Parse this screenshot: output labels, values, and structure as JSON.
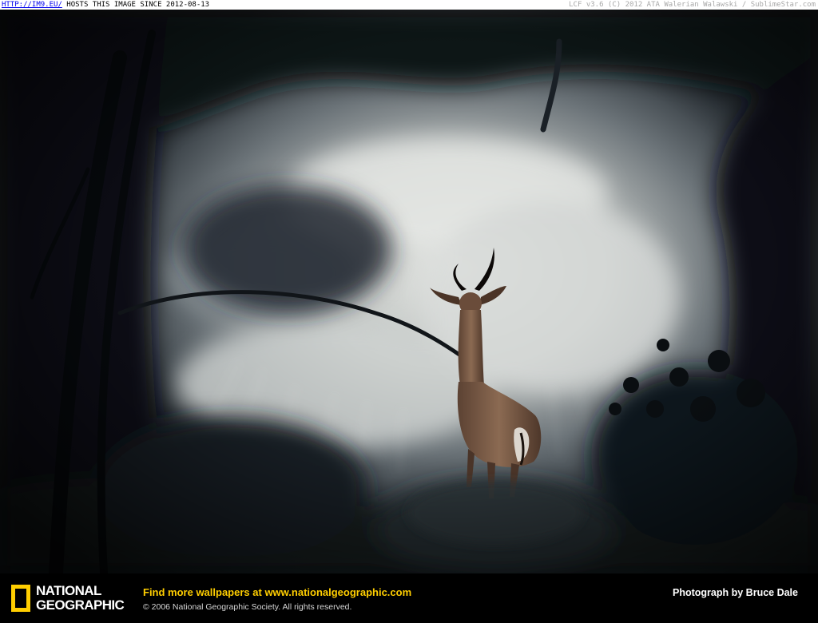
{
  "host_strip": {
    "link_text": "HTTP://IM9.EU/",
    "hosts_text": " HOSTS THIS IMAGE SINCE 2012-08-13",
    "right_text": "LCF v3.6 (C) 2012 ATA Walerian Walawski / SublimeStar.com"
  },
  "photo": {
    "subject": "gerenuk-antelope",
    "palette": {
      "dark_foliage": "#0d1116",
      "mid_foliage": "#2a3138",
      "grass_light": "#d8dbd9",
      "antelope_body": "#7a5a44"
    }
  },
  "caption": {
    "logo_line1": "NATIONAL",
    "logo_line2": "GEOGRAPHIC",
    "promo_text": "Find more wallpapers at ",
    "promo_url": "www.nationalgeographic.com",
    "copyright": "© 2006 National Geographic Society. All rights reserved.",
    "credit": "Photograph by Bruce Dale",
    "accent_color": "#ffce00"
  }
}
